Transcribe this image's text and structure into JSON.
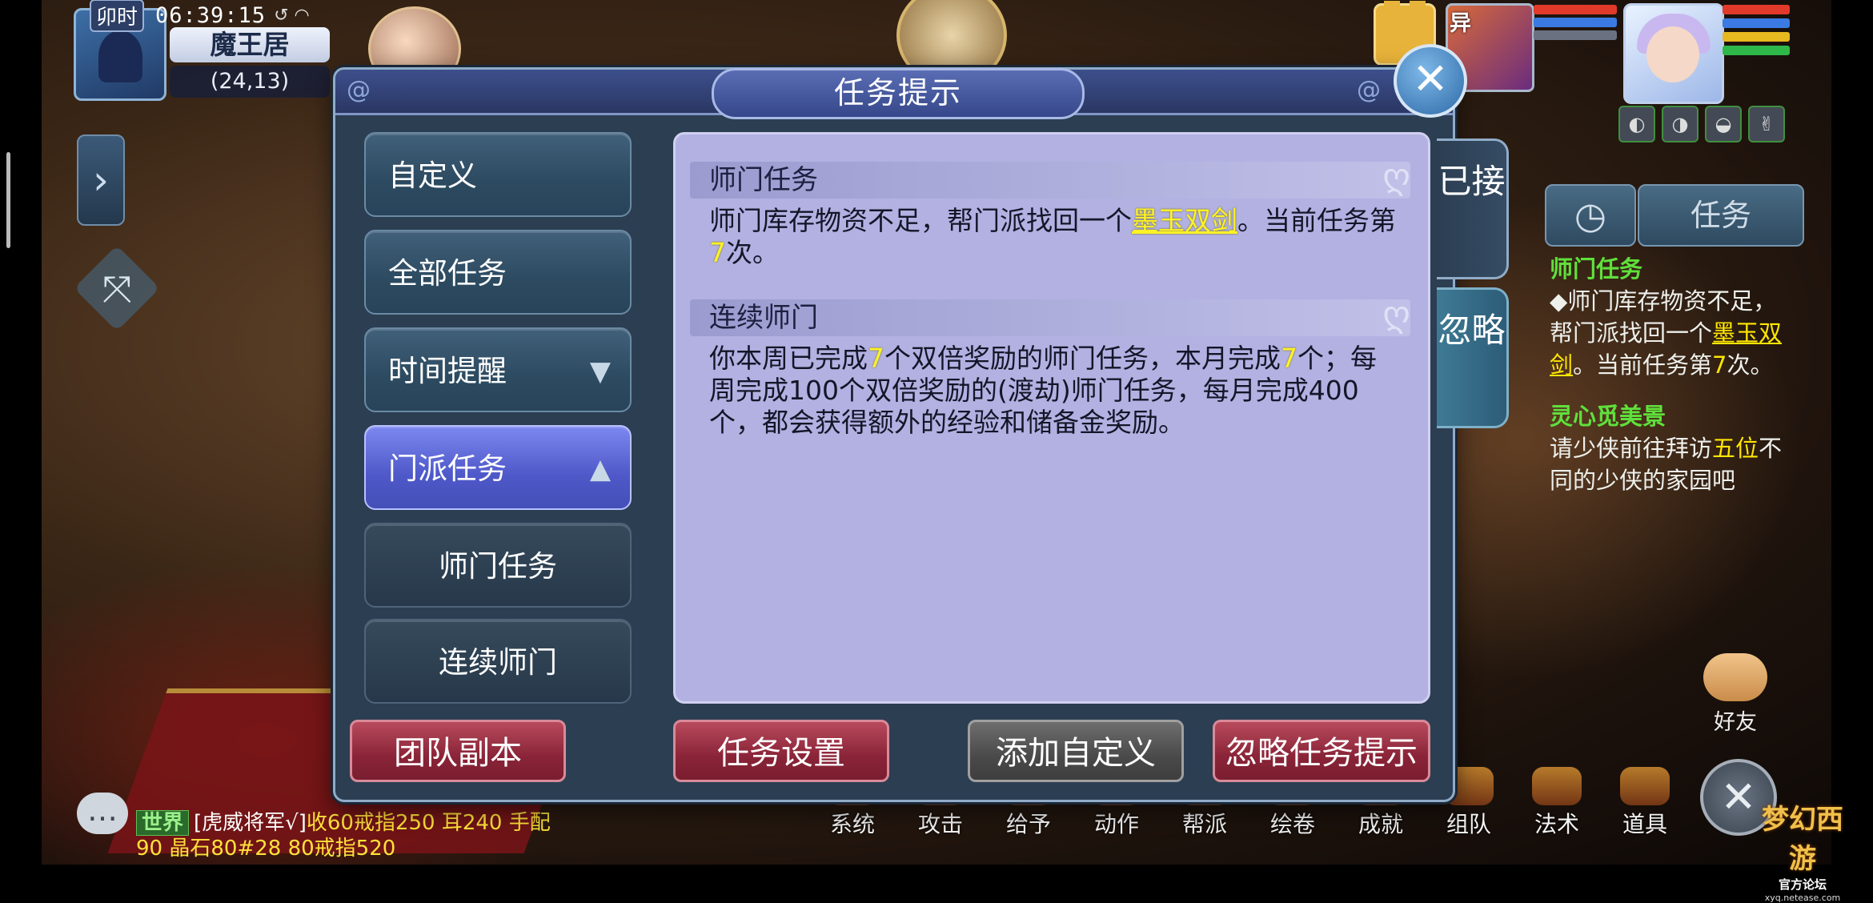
{
  "status": {
    "shichen": "卯时",
    "time": "06:39:15",
    "network": "↺ ◠"
  },
  "location": {
    "map_name": "魔王居",
    "coords": "(24,13)"
  },
  "team": {
    "badge": "异"
  },
  "colors": {
    "hp": "#e23a2a",
    "mp": "#3a7ae2",
    "exp": "#e8b820",
    "sp": "#2fb84a",
    "quest_title": "#5fe03b",
    "highlight": "#fff226"
  },
  "tracker": {
    "tab_label": "任务",
    "quests": [
      {
        "title": "师门任务",
        "body": [
          {
            "t": "◆师门库存物资不足，帮门派找回一个"
          },
          {
            "t": "墨玉双剑",
            "style": "ul"
          },
          {
            "t": "。当前任务第"
          },
          {
            "t": "7",
            "style": "y"
          },
          {
            "t": "次。"
          }
        ]
      },
      {
        "title": "灵心觅美景",
        "body": [
          {
            "t": "请少侠前往拜访"
          },
          {
            "t": "五位",
            "style": "y"
          },
          {
            "t": "不同的少侠的家园吧"
          }
        ]
      }
    ]
  },
  "friend_label": "好友",
  "logo": {
    "title": "梦幻西游",
    "subtitle": "官方论坛",
    "url": "xyq.netease.com"
  },
  "bottom_menu": [
    "系统",
    "攻击",
    "给予",
    "动作",
    "帮派",
    "绘卷",
    "成就",
    "组队",
    "法术",
    "道具"
  ],
  "chat": {
    "channel": "世界",
    "speaker": "[虎威将军√]",
    "message": "收60戒指250 耳240 手配90 晶石80#28 80戒指520"
  },
  "modal": {
    "title": "任务提示",
    "close_glyph": "✕",
    "nav": [
      {
        "label": "自定义"
      },
      {
        "label": "全部任务"
      },
      {
        "label": "时间提醒",
        "chevron": "▼"
      },
      {
        "label": "门派任务",
        "chevron": "▲",
        "active": true
      },
      {
        "label": "师门任务",
        "sub": true
      },
      {
        "label": "连续师门",
        "sub": true
      }
    ],
    "sections": [
      {
        "heading": "师门任务",
        "body": [
          {
            "t": "师门库存物资不足，帮门派找回一个"
          },
          {
            "t": "墨玉双剑",
            "style": "ul"
          },
          {
            "t": "。当前任务第"
          },
          {
            "t": "7",
            "style": "y"
          },
          {
            "t": "次。"
          }
        ]
      },
      {
        "heading": "连续师门",
        "body": [
          {
            "t": "你本周已完成"
          },
          {
            "t": "7",
            "style": "y"
          },
          {
            "t": "个双倍奖励的师门任务，本月完成"
          },
          {
            "t": "7",
            "style": "y"
          },
          {
            "t": "个；每周完成100个双倍奖励的(渡劫)师门任务，每月完成400个，都会获得额外的经验和储备金奖励。"
          }
        ]
      }
    ],
    "tabs": {
      "accepted": "已接",
      "ignored": "忽略"
    },
    "footer": {
      "team_dungeon": "团队副本",
      "task_settings": "任务设置",
      "add_custom": "添加自定义",
      "ignore_tips": "忽略任务提示"
    }
  }
}
